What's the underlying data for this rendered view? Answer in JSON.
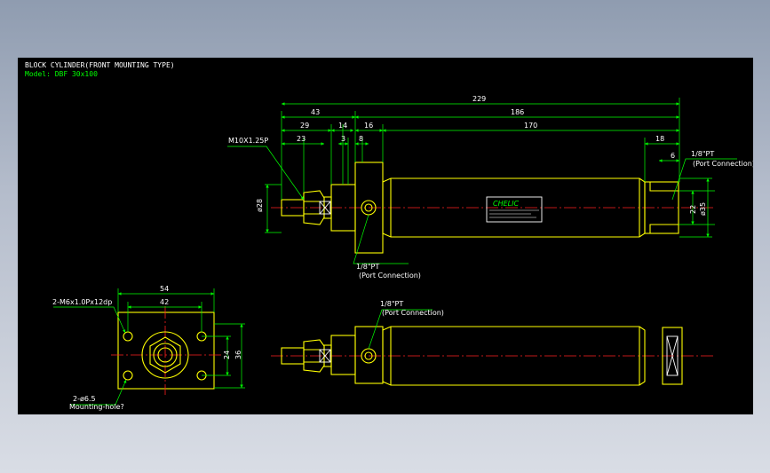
{
  "header": {
    "title": "BLOCK CYLINDER(FRONT MOUNTING TYPE)",
    "model": "Model: DBF 30x100"
  },
  "colors": {
    "outline": "#ffff00",
    "dimension": "#00ff00",
    "centerline": "#ff2020",
    "text": "#ffffff",
    "background": "#000000"
  },
  "dimensions": {
    "overall": "229",
    "front_part": "43",
    "body_part": "186",
    "d29": "29",
    "d14": "14",
    "d16": "16",
    "d170": "170",
    "d23": "23",
    "d3": "3",
    "d8": "8",
    "d18": "18",
    "d6": "6",
    "dia28": "ø28",
    "d22": "22",
    "dia35": "ø35",
    "d54": "54",
    "d42": "42",
    "d24": "24",
    "d36": "36"
  },
  "annotations": {
    "rod_thread": "M10X1.25P",
    "port_size": "1/8\"PT",
    "port_text": "(Port Connection)",
    "mount_thread": "2-M6x1.0Px12dp",
    "mount_hole": "2-ø6.5",
    "mount_hole_text": "Mounting-hole?"
  },
  "brand": {
    "logo": "CHELIC"
  }
}
